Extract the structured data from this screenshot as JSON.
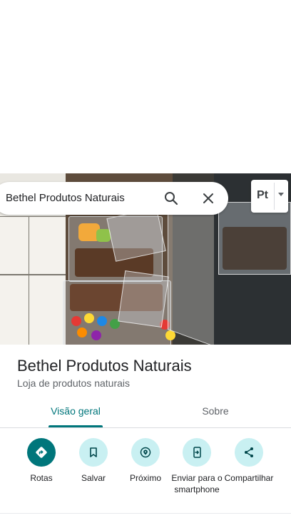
{
  "search": {
    "query": "Bethel Produtos Naturais"
  },
  "language": {
    "code": "Pt"
  },
  "place": {
    "name": "Bethel Produtos Naturais",
    "category": "Loja de produtos naturais"
  },
  "tabs": [
    {
      "label": "Visão geral",
      "selected": true
    },
    {
      "label": "Sobre",
      "selected": false
    }
  ],
  "actions": [
    {
      "label": "Rotas",
      "icon": "directions-icon"
    },
    {
      "label": "Salvar",
      "icon": "bookmark-icon"
    },
    {
      "label": "Próximo",
      "icon": "nearby-icon"
    },
    {
      "label": "Enviar para o smartphone",
      "icon": "send-to-phone-icon"
    },
    {
      "label": "Compartilhar",
      "icon": "share-icon"
    }
  ],
  "colors": {
    "accent": "#00767b",
    "action_bg": "#c9f0f2"
  }
}
